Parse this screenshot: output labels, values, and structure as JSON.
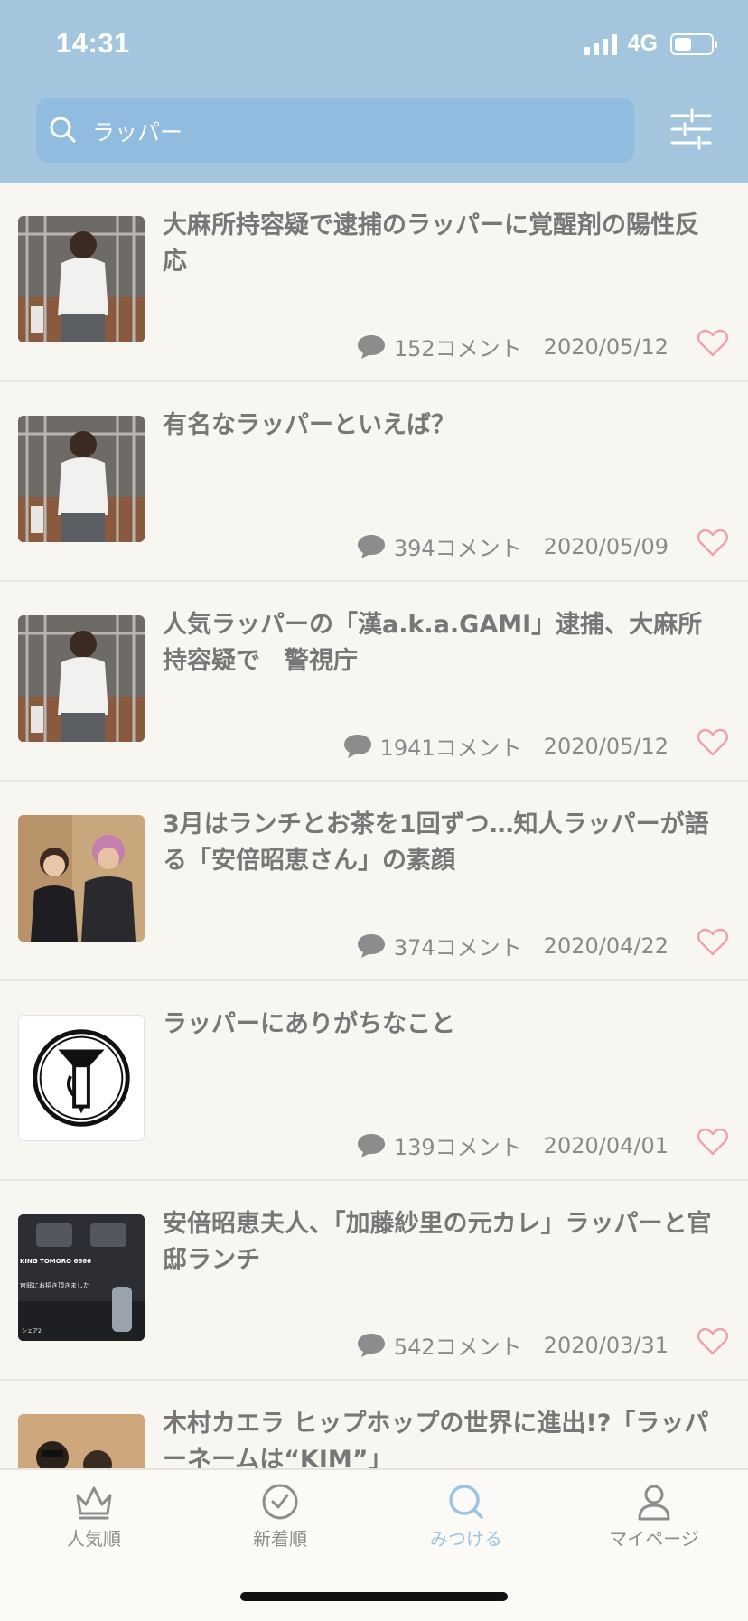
{
  "status_bar": {
    "time": "14:31",
    "network": "4G"
  },
  "search": {
    "value": "ラッパー",
    "placeholder": ""
  },
  "articles": [
    {
      "title": "大麻所持容疑で逮捕のラッパーに覚醒剤の陽性反応",
      "comments": "152コメント",
      "date": "2020/05/12",
      "thumb": "rapper-photo"
    },
    {
      "title": "有名なラッパーといえば？",
      "comments": "394コメント",
      "date": "2020/05/09",
      "thumb": "rapper-photo"
    },
    {
      "title": "人気ラッパーの「漢a.k.a.GAMI」逮捕、大麻所持容疑で　警視庁",
      "comments": "1941コメント",
      "date": "2020/05/12",
      "thumb": "rapper-photo"
    },
    {
      "title": "3月はランチとお茶を1回ずつ…知人ラッパーが語る「安倍昭恵さん」の素顔",
      "comments": "374コメント",
      "date": "2020/04/22",
      "thumb": "two-people-photo"
    },
    {
      "title": "ラッパーにありがちなこと",
      "comments": "139コメント",
      "date": "2020/04/01",
      "thumb": "trumpet-logo"
    },
    {
      "title": "安倍昭恵夫人、「加藤紗里の元カレ」ラッパーと官邸ランチ",
      "comments": "542コメント",
      "date": "2020/03/31",
      "thumb": "car-interior-photo"
    },
    {
      "title": "木村カエラ ヒップホップの世界に進出!?「ラッパーネームは“KIM”」",
      "comments": "",
      "date": "",
      "thumb": "group-photo"
    }
  ],
  "thumb_texts": {
    "car_caption_1": "KING TOMORO 6666",
    "car_caption_2": "官邸にお招き頂きました",
    "car_caption_3": "シェア2"
  },
  "tabs": [
    {
      "label": "人気順",
      "icon": "crown-icon",
      "active": false
    },
    {
      "label": "新着順",
      "icon": "clock-icon",
      "active": false
    },
    {
      "label": "みつける",
      "icon": "search-icon",
      "active": true
    },
    {
      "label": "マイページ",
      "icon": "person-icon",
      "active": false
    }
  ],
  "colors": {
    "header": "#a4c5de",
    "search_bg": "#8fbcdf",
    "accent": "#9cc4e3",
    "heart": "#f0a0a8",
    "background": "#f8f6f1"
  }
}
